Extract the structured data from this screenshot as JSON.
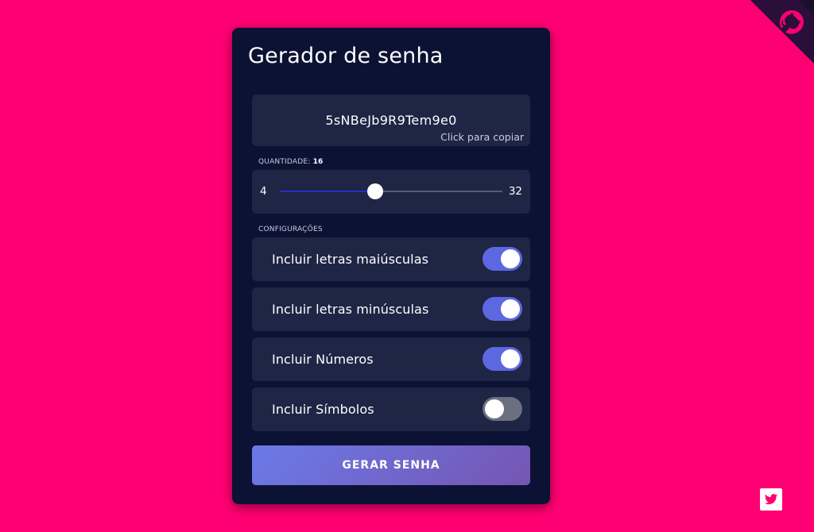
{
  "title": "Gerador de senha",
  "password": {
    "value": "5sNBeJb9R9Tem9e0",
    "hint": "Click para copiar"
  },
  "quantity": {
    "label": "QUANTIDADE:",
    "value": "16",
    "min": "4",
    "max": "32",
    "current": 16
  },
  "settings": {
    "label": "CONFIGURAÇÕES",
    "options": [
      {
        "label": "Incluir letras maiúsculas",
        "enabled": true
      },
      {
        "label": "Incluir letras minúsculas",
        "enabled": true
      },
      {
        "label": "Incluir Números",
        "enabled": true
      },
      {
        "label": "Incluir Símbolos",
        "enabled": false
      }
    ]
  },
  "generate_button": "GERAR SENHA",
  "colors": {
    "background": "#ff0072",
    "card": "#0c1233",
    "panel": "#1f2545",
    "toggle_on": "#5c67e0",
    "toggle_off": "#6b7080"
  },
  "icons": {
    "corner": "github-octocat-icon",
    "social": "twitter-icon"
  }
}
